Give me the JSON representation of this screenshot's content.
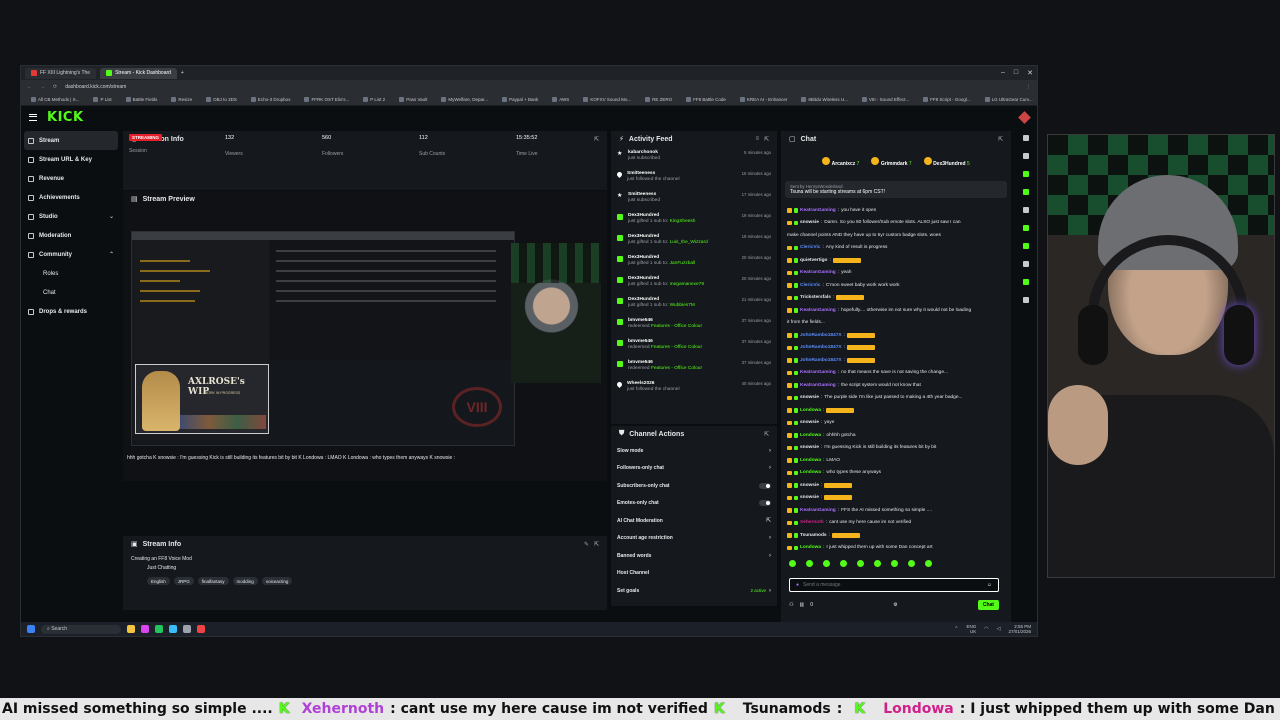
{
  "browser": {
    "tabs": [
      {
        "label": "FF XIII Lightning's The"
      },
      {
        "label": "Stream - Kick Dashboard"
      }
    ],
    "url": "dashboard.kick.com/stream",
    "bookmarks": [
      "All CB Methods | S...",
      "P List",
      "Battle Fields",
      "Resize",
      "OBJ to 3DS",
      "Echo-3 Dropbox",
      "FFRK OST Elio's...",
      "P List 2",
      "Pass Vault",
      "MyWelfare, Depar...",
      "Paypal + Bank",
      "AWS",
      "KOFXV Sound Mo...",
      "RE ZERO",
      "FF8 Battle Code",
      "KREA AI - Enhancer",
      "8Bitdo Wireless U...",
      "VIII - Sound Effect...",
      "FF8 Script - Googl...",
      "LG UltraGear Curv..."
    ]
  },
  "kick": {
    "logo": "KICK",
    "nav": [
      {
        "label": "Stream",
        "active": true
      },
      {
        "label": "Stream URL & Key"
      },
      {
        "label": "Revenue"
      },
      {
        "label": "Achievements"
      },
      {
        "label": "Studio",
        "chev": "⌄"
      },
      {
        "label": "Moderation"
      },
      {
        "label": "Community",
        "chev": "⌃"
      },
      {
        "label": "Roles",
        "sub": true
      },
      {
        "label": "Chat",
        "sub": true
      },
      {
        "label": "Drops & rewards"
      }
    ]
  },
  "session": {
    "title": "Session Info",
    "live_badge": "STREAMING",
    "session_label": "Session",
    "viewers": "132",
    "viewers_label": "Viewers",
    "followers": "560",
    "followers_label": "Followers",
    "subs": "112",
    "subs_label": "Sub Counts",
    "time": "15:35:52",
    "time_label": "Time Live"
  },
  "preview": {
    "title": "Stream Preview",
    "banner_title": "AXLROSE's WIP",
    "banner_sub": "WORK IN PROGRESS",
    "ticker": "hhh gotcha  K  snowsie : I'm guessing Kick is still building its features bit by bit  K  Londowa : LMAO  K  Londowa : who types them anyways  K  snowsie :"
  },
  "stream_info": {
    "title": "Stream Info",
    "stream_title": "Creating an FF8 Voice Mod",
    "category": "Just Chatting",
    "tags": [
      "English",
      "JRPG",
      "finalfantasy",
      "modding",
      "voiceacting"
    ]
  },
  "activity": {
    "title": "Activity Feed",
    "items": [
      {
        "icon": "star",
        "name": "kabarchonok",
        "desc": "just subscribed",
        "time": "5 minutes ago"
      },
      {
        "icon": "heart",
        "name": "Smitteeness",
        "desc": "just followed the channel",
        "time": "16 minutes ago"
      },
      {
        "icon": "star",
        "name": "Smitteeness",
        "desc": "just subscribed",
        "time": "17 minutes ago"
      },
      {
        "icon": "gift",
        "name": "Dex3Hundred",
        "desc": "just gifted 1 sub to:",
        "hl": "KingSheesh",
        "time": "19 minutes ago"
      },
      {
        "icon": "gift",
        "name": "Dex3Hundred",
        "desc": "just gifted 1 sub to:",
        "hl": "Luis_the_Wizzard",
        "time": "19 minutes ago"
      },
      {
        "icon": "gift",
        "name": "Dex3Hundred",
        "desc": "just gifted 1 sub to:",
        "hl": "JanFuzzball",
        "time": "20 minutes ago"
      },
      {
        "icon": "gift",
        "name": "Dex3Hundred",
        "desc": "just gifted 1 sub to:",
        "hl": "megamanexe79",
        "time": "20 minutes ago"
      },
      {
        "icon": "gift",
        "name": "Dex3Hundred",
        "desc": "just gifted 1 sub to:",
        "hl": "Wubbies7M",
        "time": "21 minutes ago"
      },
      {
        "icon": "gift",
        "name": "bmvme546",
        "desc": "redeemed",
        "hl": "Features - Office Colour",
        "time": "37 minutes ago"
      },
      {
        "icon": "gift",
        "name": "bmvme546",
        "desc": "redeemed",
        "hl": "Features - Office Colour",
        "time": "37 minutes ago"
      },
      {
        "icon": "gift",
        "name": "bmvme546",
        "desc": "redeemed",
        "hl": "Features - Office Colour",
        "time": "37 minutes ago"
      },
      {
        "icon": "heart",
        "name": "Wheels2026",
        "desc": "just followed the channel",
        "time": "40 minutes ago"
      }
    ]
  },
  "actions": {
    "title": "Channel Actions",
    "items": [
      {
        "label": "Slow mode",
        "type": "chev"
      },
      {
        "label": "Followers-only chat",
        "type": "chev"
      },
      {
        "label": "Subscribers-only chat",
        "type": "toggle"
      },
      {
        "label": "Emotes-only chat",
        "type": "toggle"
      },
      {
        "label": "AI Chat Moderation",
        "type": "ext"
      },
      {
        "label": "Account age restriction",
        "type": "chev"
      },
      {
        "label": "Banned words",
        "type": "chev"
      },
      {
        "label": "Host Channel",
        "type": "none"
      },
      {
        "label": "Set goals",
        "type": "goal",
        "extra": "2 active"
      }
    ]
  },
  "chat": {
    "title": "Chat",
    "leaders": [
      {
        "name": "Arcanixcz",
        "count": "7"
      },
      {
        "name": "Grimmdark",
        "count": "7"
      },
      {
        "name": "Dex3Hundred",
        "count": "5"
      }
    ],
    "pinned_by": "Sent by  HenrysWonderland",
    "pinned_text": "Tsuna will be starting streams at 6pm CST!",
    "messages": [
      {
        "user": "KeatranGaming",
        "color": "#a970ff",
        "text": "you have it open"
      },
      {
        "user": "snowsie",
        "color": "#e6e8ea",
        "text": "Damn. So you 60 follower/Sub emote slots. ALSO just saw I can"
      },
      {
        "user": "",
        "color": "#e6e8ea",
        "text": "make channel points AND they have up to 5yr custom badge slots. woes"
      },
      {
        "user": "ClericVic",
        "color": "#5b8cff",
        "text": "Any kind of result is progress"
      },
      {
        "user": "quietvertigo",
        "color": "#e6e8ea",
        "text": ""
      },
      {
        "user": "KeatranGaming",
        "color": "#a970ff",
        "text": "yeah"
      },
      {
        "user": "ClericVic",
        "color": "#5b8cff",
        "text": "C'mon sweet baby work work work"
      },
      {
        "user": "Trickstersfals",
        "color": "#e6e8ea",
        "text": ""
      },
      {
        "user": "KeatranGaming",
        "color": "#a970ff",
        "text": "hopefully.... otherwise im not sure why it would not be loading"
      },
      {
        "user": "",
        "color": "#e6e8ea",
        "text": "it from the fields..."
      },
      {
        "user": "JohnRambo1847X",
        "color": "#5b8cff",
        "text": ""
      },
      {
        "user": "JohnRambo1847X",
        "color": "#5b8cff",
        "text": ""
      },
      {
        "user": "JohnRambo1847X",
        "color": "#5b8cff",
        "text": ""
      },
      {
        "user": "KeatranGaming",
        "color": "#a970ff",
        "text": "no that means the save is not saving the change..."
      },
      {
        "user": "KeatranGaming",
        "color": "#a970ff",
        "text": "the script system would not know that"
      },
      {
        "user": "snowsie",
        "color": "#e6e8ea",
        "text": "The purple side I'm like just passed to making a 4th year badge..."
      },
      {
        "user": "Londowa",
        "color": "#53fc18",
        "text": ""
      },
      {
        "user": "snowsie",
        "color": "#e6e8ea",
        "text": "yaye"
      },
      {
        "user": "Londowa",
        "color": "#53fc18",
        "text": "ohhhh gotcha"
      },
      {
        "user": "snowsie",
        "color": "#e6e8ea",
        "text": "I'm guessing Kick is still building its features bit by bit"
      },
      {
        "user": "Londowa",
        "color": "#53fc18",
        "text": "LMAO"
      },
      {
        "user": "Londowa",
        "color": "#53fc18",
        "text": "who types these anyways"
      },
      {
        "user": "snowsie",
        "color": "#e6e8ea",
        "text": ""
      },
      {
        "user": "snowsie",
        "color": "#e6e8ea",
        "text": ""
      },
      {
        "user": "KeatranGaming",
        "color": "#a970ff",
        "text": "FFS the AI missed something so simple ...."
      },
      {
        "user": "Xehernoth",
        "color": "#d0208a",
        "text": "cant use my here cause im not verified"
      },
      {
        "user": "Tsunamods",
        "color": "#e6e8ea",
        "text": ""
      },
      {
        "user": "Londowa",
        "color": "#53fc18",
        "text": "I just whipped them up with some Dan concept art"
      }
    ],
    "input_placeholder": "Send a message",
    "send_label": "Chat",
    "count": "0"
  },
  "taskbar": {
    "search": "Search",
    "lang": "ENG",
    "region": "UK",
    "time": "2:55 PM",
    "date": "27/01/2026"
  },
  "ticker": {
    "seg1": "AI missed something so simple ....",
    "u1": "Xehernoth",
    "t1": ": cant use my here cause im not verified",
    "u2": "Tsunamods",
    "t2": ":",
    "u3": "Londowa",
    "t3": ": I just whipped them up with some Dan concept art"
  },
  "colors": {
    "accent": "#53fc18",
    "live": "#e5202a"
  }
}
